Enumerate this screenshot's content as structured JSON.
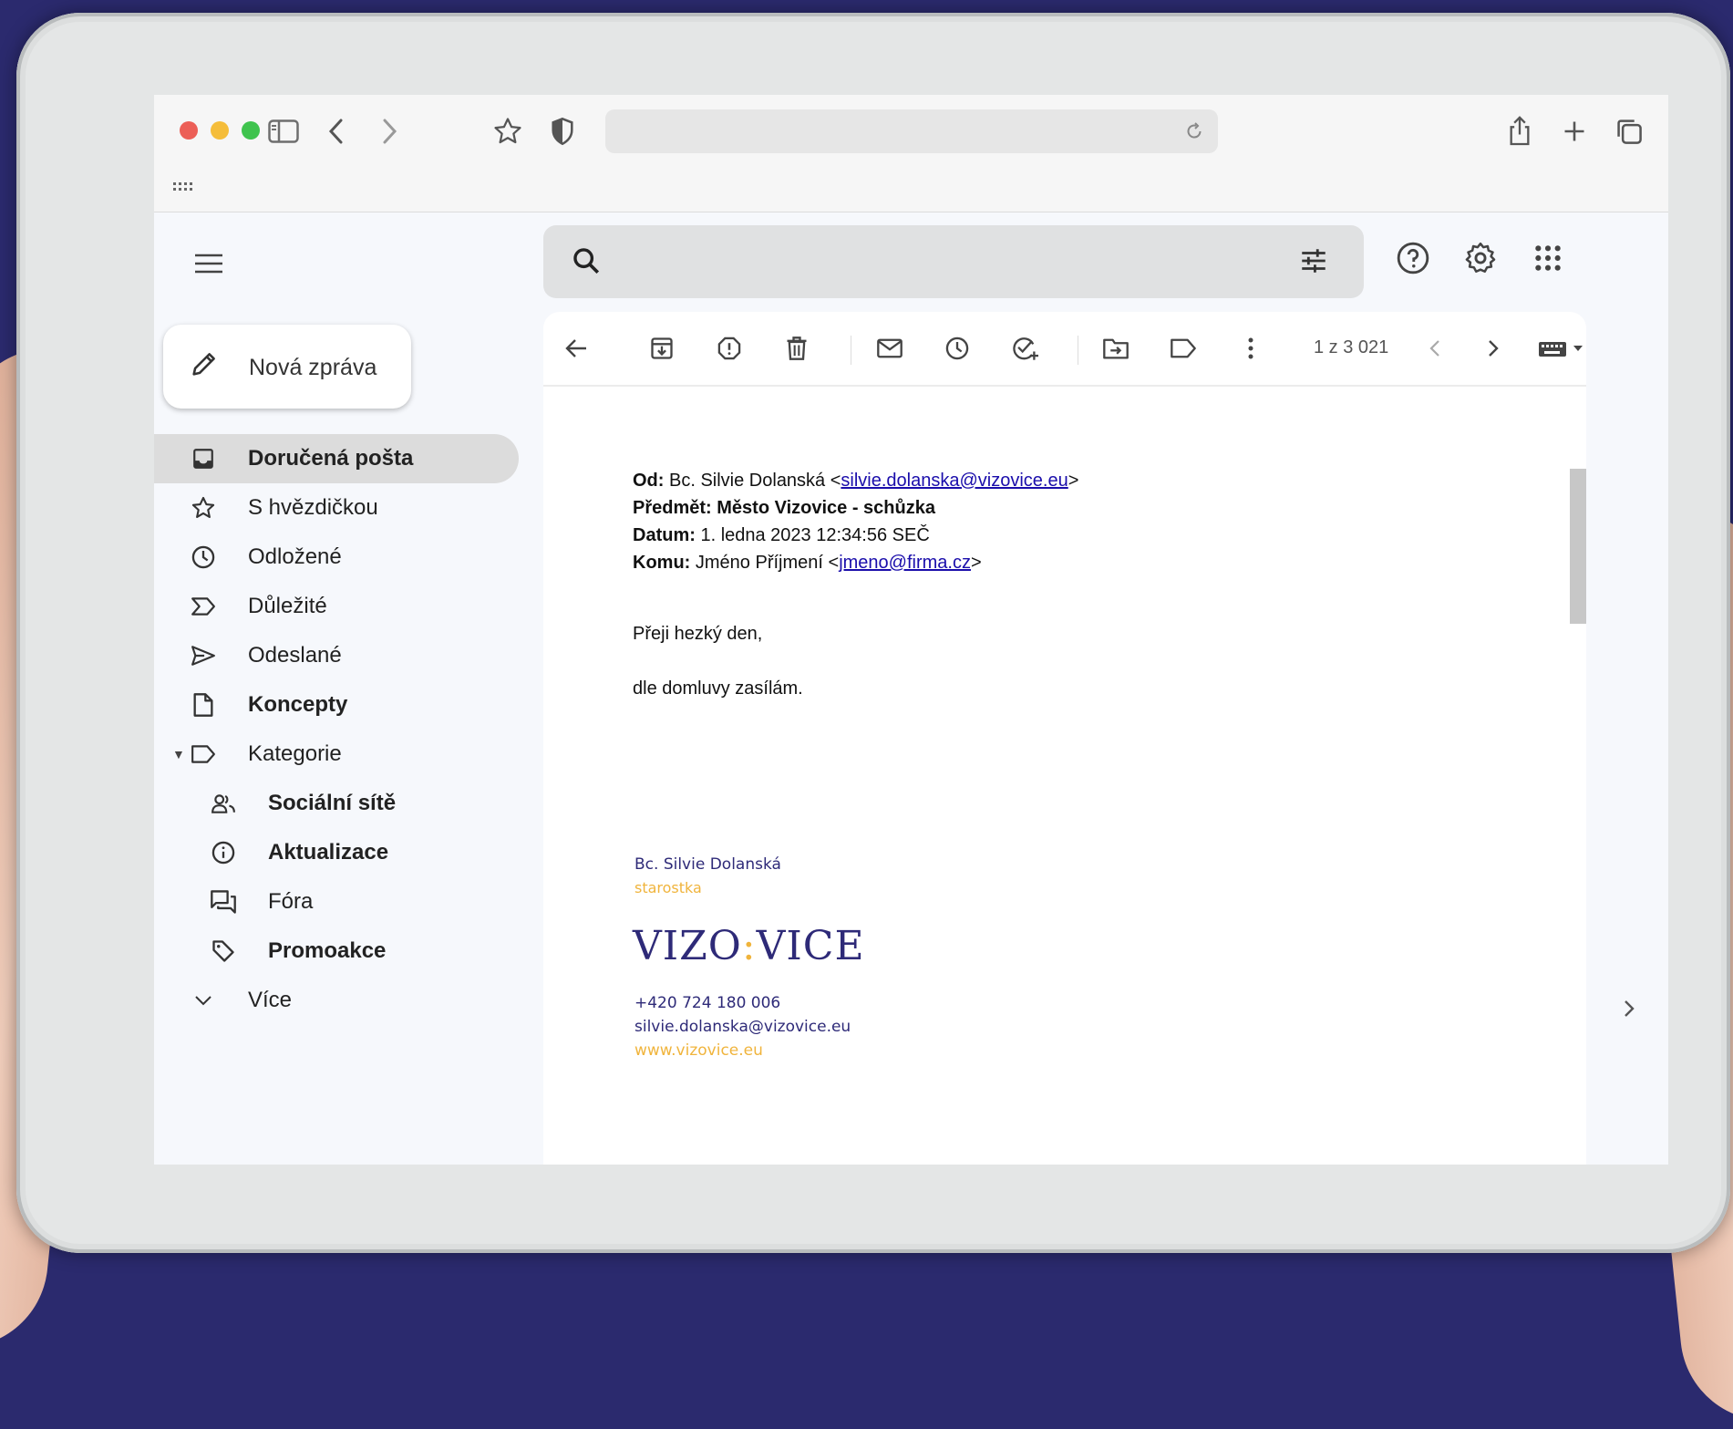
{
  "browser": {
    "url": ""
  },
  "gmail": {
    "compose_label": "Nová zpráva",
    "nav": [
      {
        "label": "Doručená pošta",
        "icon": "inbox-icon",
        "active": true,
        "bold": true
      },
      {
        "label": "S hvězdičkou",
        "icon": "star-icon"
      },
      {
        "label": "Odložené",
        "icon": "clock-icon"
      },
      {
        "label": "Důležité",
        "icon": "important-icon"
      },
      {
        "label": "Odeslané",
        "icon": "send-icon"
      },
      {
        "label": "Koncepty",
        "icon": "draft-icon",
        "bold": true
      },
      {
        "label": "Kategorie",
        "icon": "label-icon"
      },
      {
        "label": "Sociální sítě",
        "icon": "people-icon",
        "bold": true,
        "sub": true
      },
      {
        "label": "Aktualizace",
        "icon": "info-icon",
        "bold": true,
        "sub": true
      },
      {
        "label": "Fóra",
        "icon": "forum-icon",
        "sub": true
      },
      {
        "label": "Promoakce",
        "icon": "tag-icon",
        "bold": true,
        "sub": true
      },
      {
        "label": "Více",
        "icon": "chevron-down-icon"
      }
    ],
    "pager": "1 z 3 021"
  },
  "message": {
    "from_label": "Od:",
    "from_name": "Bc. Silvie Dolanská <",
    "from_email": "silvie.dolanska@vizovice.eu",
    "from_end": ">",
    "subject_label": "Předmět:",
    "subject": "Město Vizovice - schůzka",
    "date_label": "Datum:",
    "date": "1. ledna 2023 12:34:56 SEČ",
    "to_label": "Komu:",
    "to_name": "Jméno Příjmení <",
    "to_email": "jmeno@firma.cz",
    "to_end": ">",
    "greeting": "Přeji hezký den,",
    "body": "dle domluvy zasílám.",
    "signature": {
      "name": "Bc. Silvie Dolanská",
      "title": "starostka",
      "logo_left": "VIZO",
      "logo_colon": ":",
      "logo_right": "VICE",
      "phone": "+420 724 180 006",
      "email": "silvie.dolanska@vizovice.eu",
      "web": "www.vizovice.eu"
    }
  },
  "colors": {
    "brand_blue": "#2e2a78",
    "brand_yellow": "#f0b43c",
    "background": "#2b2a6e"
  }
}
